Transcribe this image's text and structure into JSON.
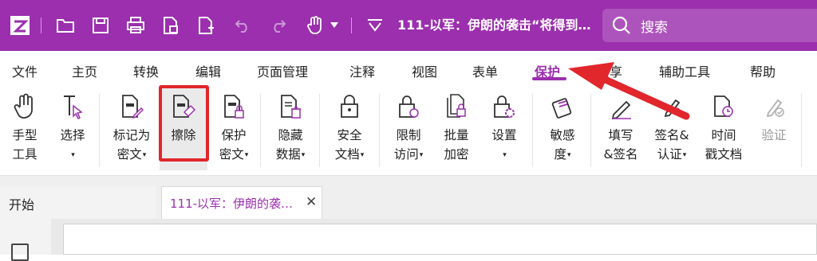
{
  "titlebar": {
    "doc_title": "111-以军：伊朗的袭击“将得到…",
    "search_placeholder": "搜索",
    "icons": [
      "app-logo-icon",
      "open-folder-icon",
      "save-icon",
      "print-icon",
      "export-icon",
      "new-doc-icon",
      "undo-icon",
      "redo-icon",
      "hand-icon",
      "dropdown-icon",
      "quick-access-icon"
    ]
  },
  "menu": {
    "tabs": [
      "文件",
      "主页",
      "转换",
      "编辑",
      "页面管理",
      "注释",
      "视图",
      "表单",
      "保护",
      "共享",
      "辅助工具",
      "帮助"
    ],
    "active": "保护"
  },
  "ribbon": {
    "hand_tool": [
      "手型",
      "工具"
    ],
    "select": "选择",
    "mark_redaction": [
      "标记为",
      "密文"
    ],
    "erase": "擦除",
    "protect_redaction": [
      "保护",
      "密文"
    ],
    "hide_data": [
      "隐藏",
      "数据"
    ],
    "secure_doc": [
      "安全",
      "文档"
    ],
    "restrict_access": [
      "限制",
      "访问"
    ],
    "batch_encrypt": [
      "批量",
      "加密"
    ],
    "settings": "设置",
    "sensitivity": [
      "敏感",
      "度"
    ],
    "fill_sign": [
      "填写",
      "&签名"
    ],
    "sign_certify": [
      "签名&",
      "认证"
    ],
    "timestamp": [
      "时间",
      "戳文档"
    ],
    "validate": "验证",
    "dropdown_glyph": "▾"
  },
  "doctabs": {
    "start": "开始",
    "active_doc": "111-以军：伊朗的袭…",
    "close": "✕"
  },
  "colors": {
    "brand": "#9b2fae",
    "highlight": "#e1262c"
  }
}
